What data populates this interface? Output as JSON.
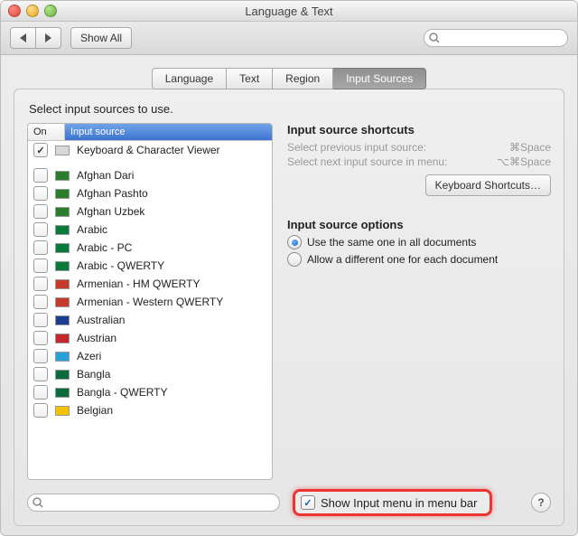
{
  "window": {
    "title": "Language & Text"
  },
  "toolbar": {
    "show_all": "Show All",
    "search_placeholder": ""
  },
  "tabs": [
    "Language",
    "Text",
    "Region",
    "Input Sources"
  ],
  "active_tab_index": 3,
  "instruction": "Select input sources to use.",
  "list": {
    "headers": {
      "on": "On",
      "source": "Input source"
    },
    "items": [
      {
        "label": "Keyboard & Character Viewer",
        "checked": true,
        "flag": "#d9d9d9",
        "separator_after": true
      },
      {
        "label": "Afghan Dari",
        "checked": false,
        "flag": "#2a7d2a"
      },
      {
        "label": "Afghan Pashto",
        "checked": false,
        "flag": "#2a7d2a"
      },
      {
        "label": "Afghan Uzbek",
        "checked": false,
        "flag": "#2a7d2a"
      },
      {
        "label": "Arabic",
        "checked": false,
        "flag": "#0a7a3c"
      },
      {
        "label": "Arabic - PC",
        "checked": false,
        "flag": "#0a7a3c"
      },
      {
        "label": "Arabic - QWERTY",
        "checked": false,
        "flag": "#0a7a3c"
      },
      {
        "label": "Armenian - HM QWERTY",
        "checked": false,
        "flag": "#c63a2b"
      },
      {
        "label": "Armenian - Western QWERTY",
        "checked": false,
        "flag": "#c63a2b"
      },
      {
        "label": "Australian",
        "checked": false,
        "flag": "#1a3d91"
      },
      {
        "label": "Austrian",
        "checked": false,
        "flag": "#c1272d"
      },
      {
        "label": "Azeri",
        "checked": false,
        "flag": "#2aa0d8"
      },
      {
        "label": "Bangla",
        "checked": false,
        "flag": "#0c6b3b"
      },
      {
        "label": "Bangla - QWERTY",
        "checked": false,
        "flag": "#0c6b3b"
      },
      {
        "label": "Belgian",
        "checked": false,
        "flag": "#f2c200"
      }
    ]
  },
  "shortcuts": {
    "heading": "Input source shortcuts",
    "prev_label": "Select previous input source:",
    "prev_keys": "⌘Space",
    "next_label": "Select next input source in menu:",
    "next_keys": "⌥⌘Space",
    "button": "Keyboard Shortcuts…"
  },
  "options": {
    "heading": "Input source options",
    "same": "Use the same one in all documents",
    "diff": "Allow a different one for each document",
    "selected": "same"
  },
  "bottom": {
    "show_menu": "Show Input menu in menu bar",
    "show_menu_checked": true,
    "help": "?"
  }
}
